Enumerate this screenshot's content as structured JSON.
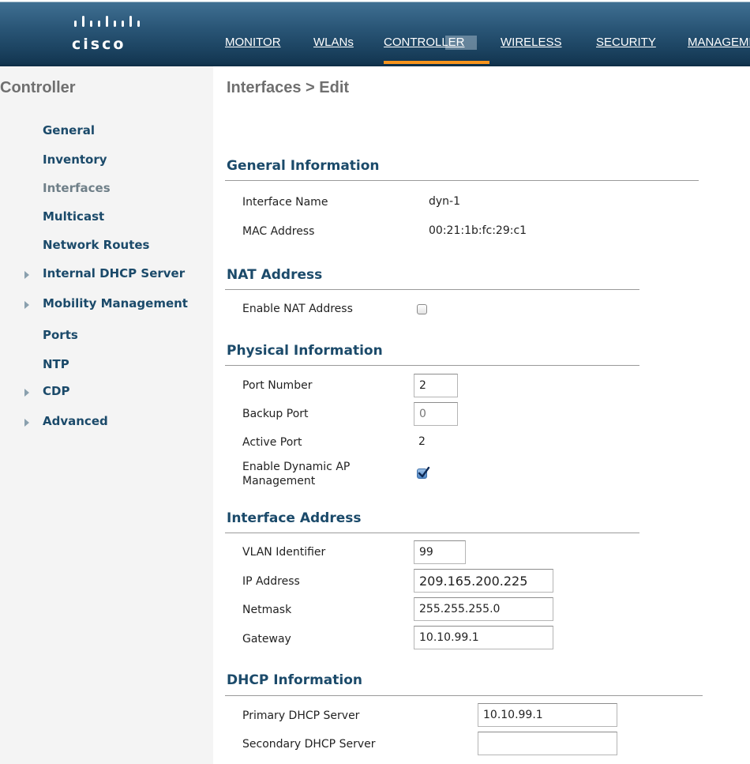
{
  "brand": {
    "logo_text": "cisco"
  },
  "nav": {
    "items": [
      {
        "label": "MONITOR"
      },
      {
        "label": "WLANs"
      },
      {
        "label": "CONTROLLER"
      },
      {
        "label": "WIRELESS"
      },
      {
        "label": "SECURITY"
      },
      {
        "label": "MANAGEMENT"
      }
    ],
    "active": "CONTROLLER"
  },
  "sidebar": {
    "title": "Controller",
    "current": "Interfaces",
    "items": [
      {
        "label": "General",
        "expandable": false
      },
      {
        "label": "Inventory",
        "expandable": false
      },
      {
        "label": "Interfaces",
        "expandable": false
      },
      {
        "label": "Multicast",
        "expandable": false
      },
      {
        "label": "Network Routes",
        "expandable": false
      },
      {
        "label": "Internal DHCP Server",
        "expandable": true
      },
      {
        "label": "Mobility Management",
        "expandable": true
      },
      {
        "label": "Ports",
        "expandable": false
      },
      {
        "label": "NTP",
        "expandable": false
      },
      {
        "label": "CDP",
        "expandable": true
      },
      {
        "label": "Advanced",
        "expandable": true
      }
    ]
  },
  "page": {
    "title": "Interfaces > Edit"
  },
  "general": {
    "title": "General Information",
    "interface_name_label": "Interface Name",
    "interface_name": "dyn-1",
    "mac_label": "MAC Address",
    "mac": "00:21:1b:fc:29:c1"
  },
  "nat": {
    "title": "NAT Address",
    "enable_label": "Enable NAT Address",
    "enabled": false
  },
  "physical": {
    "title": "Physical Information",
    "port_number_label": "Port Number",
    "port_number": "2",
    "backup_port_label": "Backup Port",
    "backup_port": "0",
    "active_port_label": "Active Port",
    "active_port": "2",
    "dyn_ap_label_line1": "Enable Dynamic AP",
    "dyn_ap_label_line2": "Management",
    "dyn_ap_enabled": true
  },
  "iface_addr": {
    "title": "Interface Address",
    "vlan_label": "VLAN Identifier",
    "vlan": "99",
    "ip_label": "IP Address",
    "ip": "209.165.200.225",
    "netmask_label": "Netmask",
    "netmask": "255.255.255.0",
    "gateway_label": "Gateway",
    "gateway": "10.10.99.1"
  },
  "dhcp": {
    "title": "DHCP Information",
    "primary_label": "Primary DHCP Server",
    "primary": "10.10.99.1",
    "secondary_label": "Secondary DHCP Server",
    "secondary": ""
  },
  "colors": {
    "nav_bg": "#1d4563",
    "nav_active_underline": "#f7941d",
    "section_title": "#1b4a6a",
    "sidebar_bg": "#f4f4f4",
    "checkbox_checked": "#4f86c4"
  }
}
